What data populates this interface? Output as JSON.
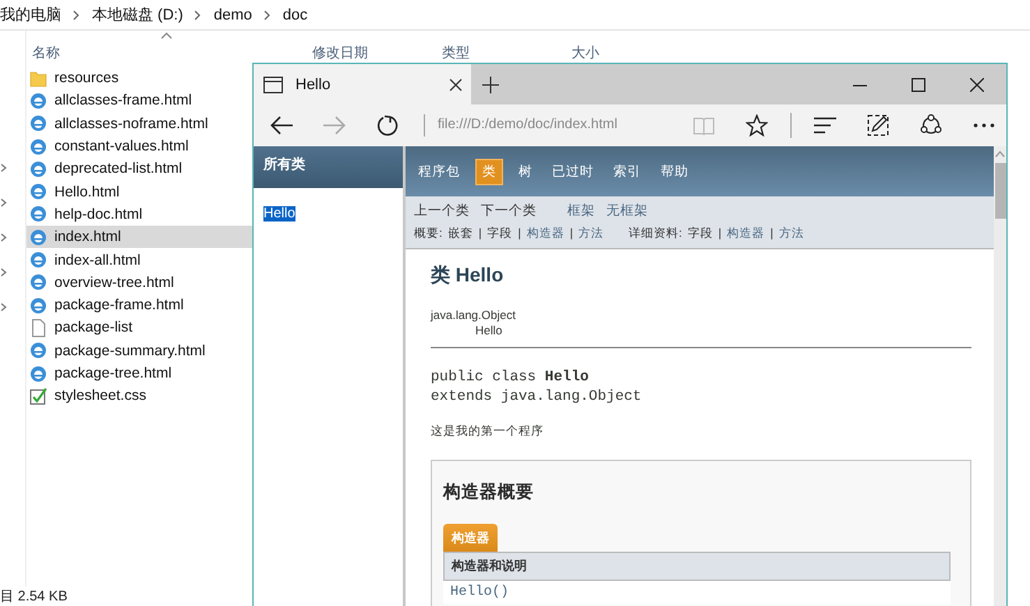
{
  "explorer": {
    "breadcrumb": [
      "我的电脑",
      "本地磁盘 (D:)",
      "demo",
      "doc"
    ],
    "columns": [
      "名称",
      "修改日期",
      "类型",
      "大小"
    ],
    "files": [
      {
        "name": "resources",
        "kind": "folder",
        "selected": false
      },
      {
        "name": "allclasses-frame.html",
        "kind": "html",
        "selected": false
      },
      {
        "name": "allclasses-noframe.html",
        "kind": "html",
        "selected": false
      },
      {
        "name": "constant-values.html",
        "kind": "html",
        "selected": false
      },
      {
        "name": "deprecated-list.html",
        "kind": "html",
        "selected": false
      },
      {
        "name": "Hello.html",
        "kind": "html",
        "selected": false
      },
      {
        "name": "help-doc.html",
        "kind": "html",
        "selected": false
      },
      {
        "name": "index.html",
        "kind": "html",
        "selected": true
      },
      {
        "name": "index-all.html",
        "kind": "html",
        "selected": false
      },
      {
        "name": "overview-tree.html",
        "kind": "html",
        "selected": false
      },
      {
        "name": "package-frame.html",
        "kind": "html",
        "selected": false
      },
      {
        "name": "package-list",
        "kind": "file",
        "selected": false
      },
      {
        "name": "package-summary.html",
        "kind": "html",
        "selected": false
      },
      {
        "name": "package-tree.html",
        "kind": "html",
        "selected": false
      },
      {
        "name": "stylesheet.css",
        "kind": "css",
        "selected": false
      }
    ],
    "status": "目  2.54 KB"
  },
  "browser": {
    "tab": {
      "title": "Hello"
    },
    "address": "file:///D:/demo/doc/index.html",
    "left_frame": {
      "header": "所有类",
      "classes": [
        {
          "name": "Hello",
          "selected": true
        }
      ]
    },
    "nav": [
      {
        "label": "程序包",
        "selected": false
      },
      {
        "label": "类",
        "selected": true
      },
      {
        "label": "树",
        "selected": false
      },
      {
        "label": "已过时",
        "selected": false
      },
      {
        "label": "索引",
        "selected": false
      },
      {
        "label": "帮助",
        "selected": false
      }
    ],
    "subnav": [
      [
        [
          {
            "text": "上一个类",
            "link": false
          },
          {
            "text": "下一个类",
            "link": false
          }
        ],
        [
          {
            "text": "框架",
            "link": true
          },
          {
            "text": "无框架",
            "link": true
          }
        ]
      ],
      [
        [
          {
            "text": "概要:",
            "link": false
          },
          {
            "text": "嵌套",
            "link": false
          },
          {
            "text": "|",
            "link": false
          },
          {
            "text": "字段",
            "link": false
          },
          {
            "text": "|",
            "link": false
          },
          {
            "text": "构造器",
            "link": true
          },
          {
            "text": "|",
            "link": false
          },
          {
            "text": "方法",
            "link": true
          }
        ],
        [
          {
            "text": "详细资料:",
            "link": false
          },
          {
            "text": "字段",
            "link": false
          },
          {
            "text": "|",
            "link": false
          },
          {
            "text": "构造器",
            "link": true
          },
          {
            "text": "|",
            "link": false
          },
          {
            "text": "方法",
            "link": true
          }
        ]
      ]
    ],
    "title": "类 Hello",
    "inheritance": [
      "java.lang.Object",
      "Hello"
    ],
    "signature": [
      "public class **Hello**",
      "extends java.lang.Object"
    ],
    "description": "这是我的第一个程序",
    "summary": {
      "title": "构造器概要",
      "tab": "构造器",
      "header": "构造器和说明",
      "rows": [
        "Hello()"
      ]
    }
  }
}
